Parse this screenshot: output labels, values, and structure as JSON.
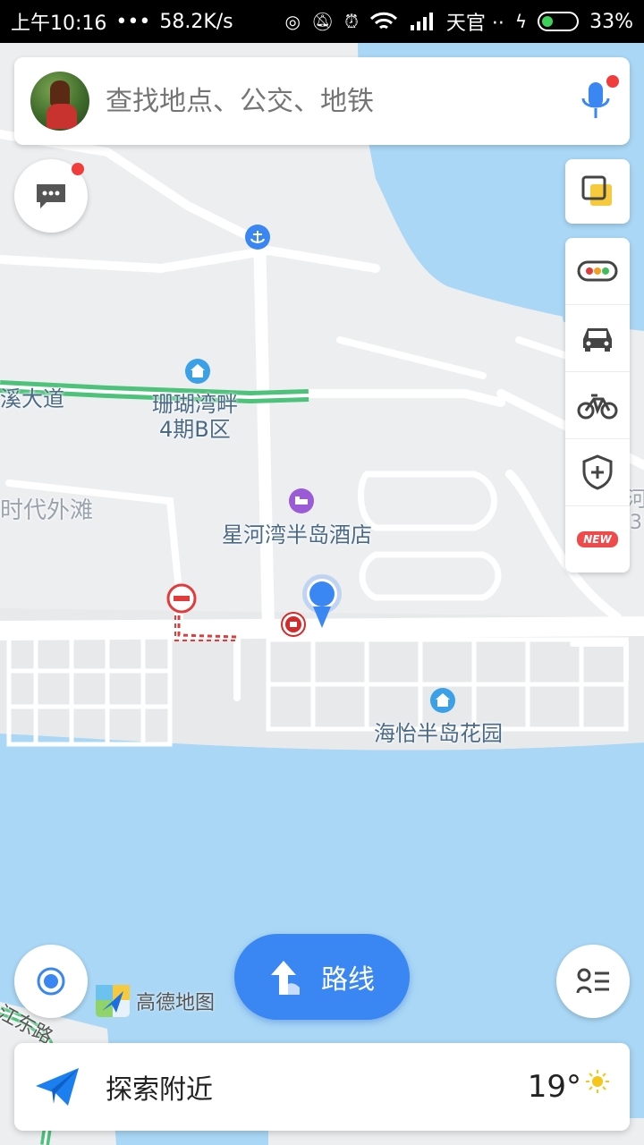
{
  "status_bar": {
    "time": "上午10:16",
    "dots": "•••",
    "speed": "58.2K/s",
    "carrier": "天官 ··",
    "battery_percent": 33,
    "battery_text": "33%"
  },
  "search": {
    "placeholder": "查找地点、公交、地铁"
  },
  "map_labels": {
    "road_west": "溪大道",
    "estate_1_line1": "珊瑚湾畔",
    "estate_1_line2": "4期B区",
    "district_gray": "时代外滩",
    "hotel": "星河湾半岛酒店",
    "estate_2": "海怡半岛花园",
    "right_edge_1": "河",
    "right_edge_2": "3",
    "road_sw": "江东路"
  },
  "toolbar": {
    "new_badge": "NEW"
  },
  "route_button": {
    "label": "路线"
  },
  "brand": {
    "name": "高德地图"
  },
  "bottom_card": {
    "explore_label": "探索附近",
    "temperature": "19°"
  },
  "colors": {
    "accent_blue": "#3a86f3",
    "water": "#a9d7f5",
    "land": "#eceef0",
    "road_green": "#4cc27a",
    "alert_red": "#f23b3b"
  },
  "icons": [
    "avatar",
    "microphone-icon",
    "message-icon",
    "anchor-icon",
    "layers-icon",
    "traffic-icon",
    "taxi-icon",
    "bike-icon",
    "shield-icon",
    "location-pin-icon",
    "hotel-icon",
    "estate-icon",
    "no-entry-icon",
    "subway-icon",
    "locate-icon",
    "route-arrow-icon",
    "list-icon",
    "paper-plane-icon",
    "sun-icon"
  ]
}
